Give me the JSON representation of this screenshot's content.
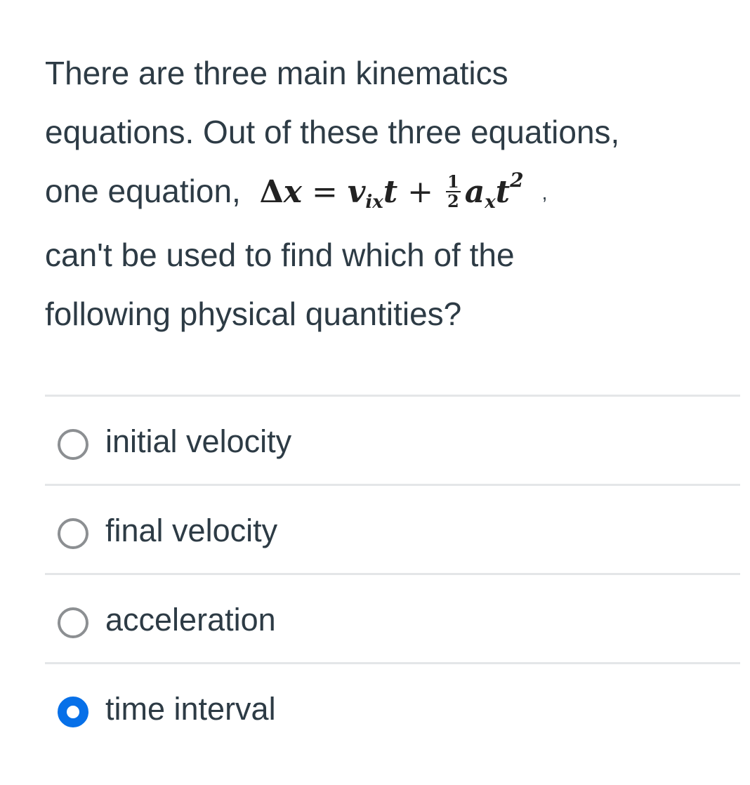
{
  "question": {
    "line1": "There are three main kinematics",
    "line2": "equations. Out of these three equations,",
    "line3_prefix": "one equation,",
    "equation": {
      "delta": "Δ",
      "x": "x",
      "equals": "=",
      "v": "v",
      "v_sub": "ix",
      "t1": "t",
      "plus": "+",
      "frac_num": "1",
      "frac_den": "2",
      "a": "a",
      "a_sub": "x",
      "t2": "t",
      "t2_sup": "2"
    },
    "line3_suffix": ",",
    "line4": "can't be used to find which of the",
    "line5": "following physical quantities?"
  },
  "options": [
    {
      "label": "initial velocity",
      "selected": false
    },
    {
      "label": "final velocity",
      "selected": false
    },
    {
      "label": "acceleration",
      "selected": false
    },
    {
      "label": "time interval",
      "selected": true
    }
  ],
  "colors": {
    "text": "#2d3b45",
    "radio_selected": "#0770e8",
    "radio_unselected": "#8c8f92",
    "divider": "#e4e6e8"
  }
}
